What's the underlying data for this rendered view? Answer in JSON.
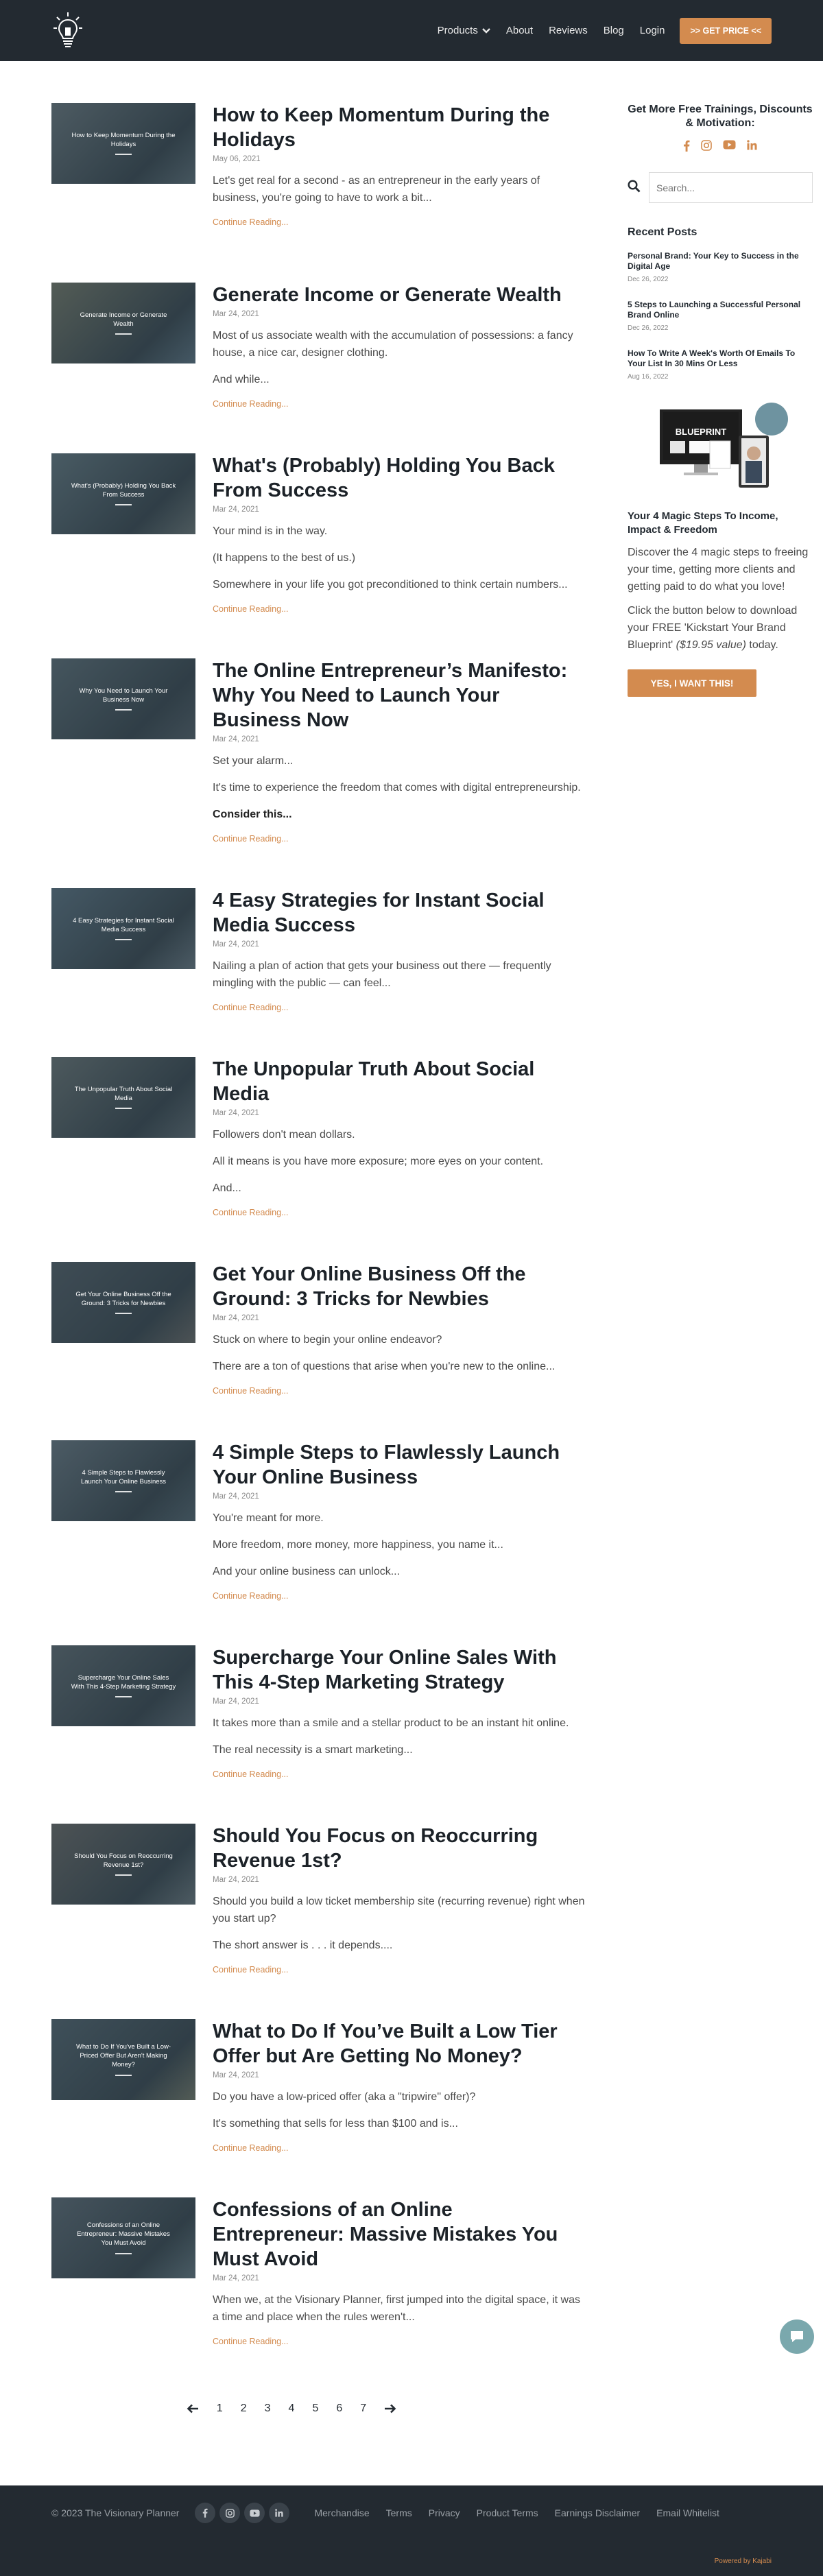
{
  "nav": {
    "items": [
      {
        "label": "Products",
        "has_dropdown": true
      },
      {
        "label": "About"
      },
      {
        "label": "Reviews"
      },
      {
        "label": "Blog"
      },
      {
        "label": "Login"
      }
    ],
    "cta_label": ">> GET PRICE <<"
  },
  "posts": [
    {
      "thumb": "How to Keep Momentum During the Holidays",
      "title": "How to Keep Momentum During the Holidays",
      "date": "May 06, 2021",
      "paras": [
        "Let's get real for a second - as an entrepreneur in the early years of business, you're going to have to work a bit..."
      ],
      "continue": "Continue Reading..."
    },
    {
      "thumb": "Generate Income or Generate Wealth",
      "title": "Generate Income or Generate Wealth",
      "date": "Mar 24, 2021",
      "paras": [
        "Most of us associate wealth with the accumulation of possessions: a fancy house, a nice car, designer clothing.",
        "And while..."
      ],
      "continue": "Continue Reading..."
    },
    {
      "thumb": "What's (Probably) Holding You Back From Success",
      "title": "What's (Probably) Holding You Back From Success",
      "date": "Mar 24, 2021",
      "paras": [
        "Your mind is in the way.",
        "(It happens to the best of us.)",
        "Somewhere in your life you got preconditioned to think certain numbers..."
      ],
      "continue": "Continue Reading..."
    },
    {
      "thumb": "Why You Need to Launch Your Business Now",
      "title": "The Online Entrepreneur’s Manifesto: Why You Need to Launch Your Business Now",
      "date": "Mar 24, 2021",
      "paras": [
        "Set your alarm...",
        "It's time to experience the freedom that comes with digital entrepreneurship.",
        "Consider this..."
      ],
      "strong_last": true,
      "continue": "Continue Reading..."
    },
    {
      "thumb": "4 Easy Strategies for Instant Social Media Success",
      "title": "4 Easy Strategies for Instant Social Media Success",
      "date": "Mar 24, 2021",
      "paras": [
        "Nailing a plan of action that gets your business out there — frequently mingling with the public — can feel..."
      ],
      "continue": "Continue Reading..."
    },
    {
      "thumb": "The Unpopular Truth About Social Media",
      "title": "The Unpopular Truth About Social Media",
      "date": "Mar 24, 2021",
      "paras": [
        "Followers don't mean dollars.",
        "All it means is you have more exposure; more eyes on your content.",
        "And..."
      ],
      "continue": "Continue Reading..."
    },
    {
      "thumb": "Get Your Online Business Off the Ground: 3 Tricks for Newbies",
      "title": "Get Your Online Business Off the Ground: 3 Tricks for Newbies",
      "date": "Mar 24, 2021",
      "paras": [
        "Stuck on where to begin your online endeavor?",
        "There are a ton of questions that arise when you're new to the online..."
      ],
      "continue": "Continue Reading..."
    },
    {
      "thumb": "4 Simple Steps to Flawlessly Launch Your Online Business",
      "title": "4 Simple Steps to Flawlessly Launch Your Online Business",
      "date": "Mar 24, 2021",
      "paras": [
        "You're meant for more.",
        "More freedom, more money, more happiness, you name it...",
        "And your online business can unlock..."
      ],
      "continue": "Continue Reading..."
    },
    {
      "thumb": "Supercharge Your Online Sales With This 4-Step Marketing Strategy",
      "title": "Supercharge Your Online Sales With This 4-Step Marketing Strategy",
      "date": "Mar 24, 2021",
      "paras": [
        "It takes more than a smile and a stellar product to be an instant hit online.",
        "The real necessity is a smart marketing..."
      ],
      "continue": "Continue Reading..."
    },
    {
      "thumb": "Should You Focus on Reoccurring Revenue 1st?",
      "title": "Should You Focus on Reoccurring Revenue 1st?",
      "date": "Mar 24, 2021",
      "paras": [
        "Should you build a low ticket membership site (recurring revenue) right when you start up?",
        "The short answer is . . . it depends...."
      ],
      "continue": "Continue Reading..."
    },
    {
      "thumb": "What to Do If You've Built a Low-Priced Offer But Aren't Making Money?",
      "title": "What to Do If You’ve Built a Low Tier Offer but Are Getting No Money?",
      "date": "Mar 24, 2021",
      "paras": [
        "Do you have a low-priced offer (aka a \"tripwire\" offer)?",
        "It's something that sells for less than $100 and is..."
      ],
      "continue": "Continue Reading..."
    },
    {
      "thumb": "Confessions of an Online Entrepreneur: Massive Mistakes You Must Avoid",
      "title": "Confessions of an Online Entrepreneur: Massive Mistakes You Must Avoid",
      "date": "Mar 24, 2021",
      "paras": [
        "When we, at the Visionary Planner, first jumped into the digital space, it was a time and place when the rules weren't..."
      ],
      "continue": "Continue Reading..."
    }
  ],
  "sidebar": {
    "heading": "Get More Free Trainings, Discounts & Motivation:",
    "search_placeholder": "Search...",
    "recent_heading": "Recent Posts",
    "recent": [
      {
        "title": "Personal Brand: Your Key to Success in the Digital Age",
        "date": "Dec 26, 2022"
      },
      {
        "title": "5 Steps to Launching a Successful Personal Brand Online",
        "date": "Dec 26, 2022"
      },
      {
        "title": "How To Write A Week's Worth Of Emails To Your List In 30 Mins Or Less",
        "date": "Aug 16, 2022"
      }
    ],
    "blueprint_label": "BLUEPRINT",
    "blueprint_title": "Your 4 Magic Steps To Income, Impact & Freedom",
    "blueprint_p1": "Discover the 4 magic steps to freeing your time, getting more clients and getting paid to do what you love!",
    "blueprint_p2_a": "Click the button below to download your FREE 'Kickstart Your Brand Blueprint' ",
    "blueprint_p2_b": "($19.95 value)",
    "blueprint_p2_c": " today.",
    "cta": "YES, I WANT THIS!"
  },
  "pagination": [
    "1",
    "2",
    "3",
    "4",
    "5",
    "6",
    "7"
  ],
  "footer": {
    "copyright": "© 2023 The Visionary Planner",
    "links": [
      "Merchandise",
      "Terms",
      "Privacy",
      "Product Terms",
      "Earnings Disclaimer",
      "Email Whitelist"
    ],
    "powered": "Powered by Kajabi"
  },
  "colors": {
    "accent": "#d38b4f",
    "header_bg": "#232a31",
    "footer_bg": "#232a31"
  }
}
